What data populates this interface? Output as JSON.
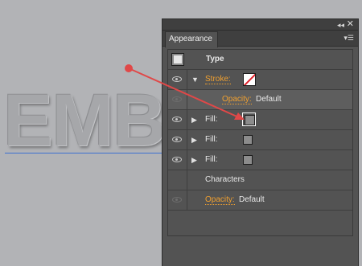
{
  "canvas": {
    "art_text": "EMB"
  },
  "panel": {
    "tab_label": "Appearance",
    "collapse_icon": "double-chevron-right-icon",
    "close_icon": "close-icon",
    "menu_icon": "panel-menu-icon"
  },
  "rows": {
    "type": {
      "label": "Type"
    },
    "stroke": {
      "label": "Stroke:",
      "swatch_color": "#ffffff",
      "none_slash_color": "#e0202a"
    },
    "stroke_opacity": {
      "label": "Opacity:",
      "value": "Default"
    },
    "fill1": {
      "label": "Fill:",
      "swatch_color": "#8c8c8c"
    },
    "fill2": {
      "label": "Fill:",
      "swatch_color": "#8c8c8c"
    },
    "fill3": {
      "label": "Fill:",
      "swatch_color": "#8c8c8c"
    },
    "characters": {
      "label": "Characters"
    },
    "opacity": {
      "label": "Opacity:",
      "value": "Default"
    }
  },
  "colors": {
    "accent_orange": "#f0a030",
    "annotation_red": "#e04848",
    "guide_blue": "#3c6fd0"
  }
}
